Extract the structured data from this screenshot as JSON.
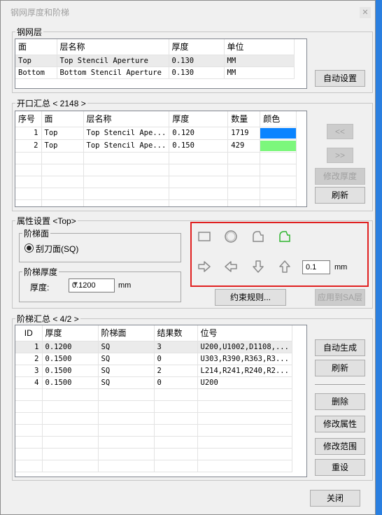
{
  "window": {
    "title": "钢网厚度和阶梯",
    "close_icon": "close-icon"
  },
  "stencil_layers": {
    "legend": "钢网层",
    "columns": [
      "面",
      "层名称",
      "厚度",
      "单位"
    ],
    "rows": [
      [
        "Top",
        "Top Stencil Aperture",
        "0.130",
        "MM"
      ],
      [
        "Bottom",
        "Bottom Stencil Aperture",
        "0.130",
        "MM"
      ]
    ],
    "auto_set_label": "自动设置"
  },
  "openings": {
    "legend": "开口汇总 < 2148 >",
    "columns": [
      "序号",
      "面",
      "层名称",
      "厚度",
      "数量",
      "颜色"
    ],
    "rows": [
      {
        "index": "1",
        "side": "Top",
        "layer": "Top Stencil Ape...",
        "thickness": "0.120",
        "count": "1719",
        "color": "#0a84ff"
      },
      {
        "index": "2",
        "side": "Top",
        "layer": "Top Stencil Ape...",
        "thickness": "0.150",
        "count": "429",
        "color": "#7cf77c"
      }
    ],
    "prev_label": "<<",
    "next_label": ">>",
    "modify_thickness_label": "修改厚度",
    "refresh_label": "刷新"
  },
  "properties": {
    "legend": "属性设置 <Top>",
    "step_face_legend": "阶梯面",
    "radio_label": "刮刀面(SQ)",
    "step_thickness_legend": "阶梯厚度",
    "thickness_label": "厚度:",
    "thickness_value": "0.1200",
    "thickness_unit": "mm",
    "shapes": [
      "rectangle-icon",
      "circle-icon",
      "chamfer-shape-icon",
      "chamfer-shape-green-icon"
    ],
    "arrows": [
      "arrow-right-icon",
      "arrow-left-icon",
      "arrow-down-icon",
      "arrow-up-icon"
    ],
    "offset_value": "0.1",
    "offset_unit": "mm",
    "constraint_rules_label": "约束规则...",
    "apply_sa_label": "应用到SA层"
  },
  "step_summary": {
    "legend": "阶梯汇总 < 4/2 >",
    "columns": [
      "ID",
      "厚度",
      "阶梯面",
      "结果数",
      "位号"
    ],
    "rows": [
      [
        "1",
        "0.1200",
        "SQ",
        "3",
        "U200,U1002,D1108,..."
      ],
      [
        "2",
        "0.1500",
        "SQ",
        "0",
        "U303,R390,R363,R3..."
      ],
      [
        "3",
        "0.1500",
        "SQ",
        "2",
        "L214,R241,R240,R2..."
      ],
      [
        "4",
        "0.1500",
        "SQ",
        "0",
        "U200"
      ]
    ],
    "auto_generate_label": "自动生成",
    "refresh_label": "刷新",
    "delete_label": "删除",
    "modify_props_label": "修改属性",
    "modify_range_label": "修改范围",
    "reset_label": "重设"
  },
  "footer": {
    "close_label": "关闭"
  },
  "colors": {
    "highlight_box": "#e02020",
    "green_shape": "#2fb52f",
    "icon_gray": "#8a8a8a"
  }
}
